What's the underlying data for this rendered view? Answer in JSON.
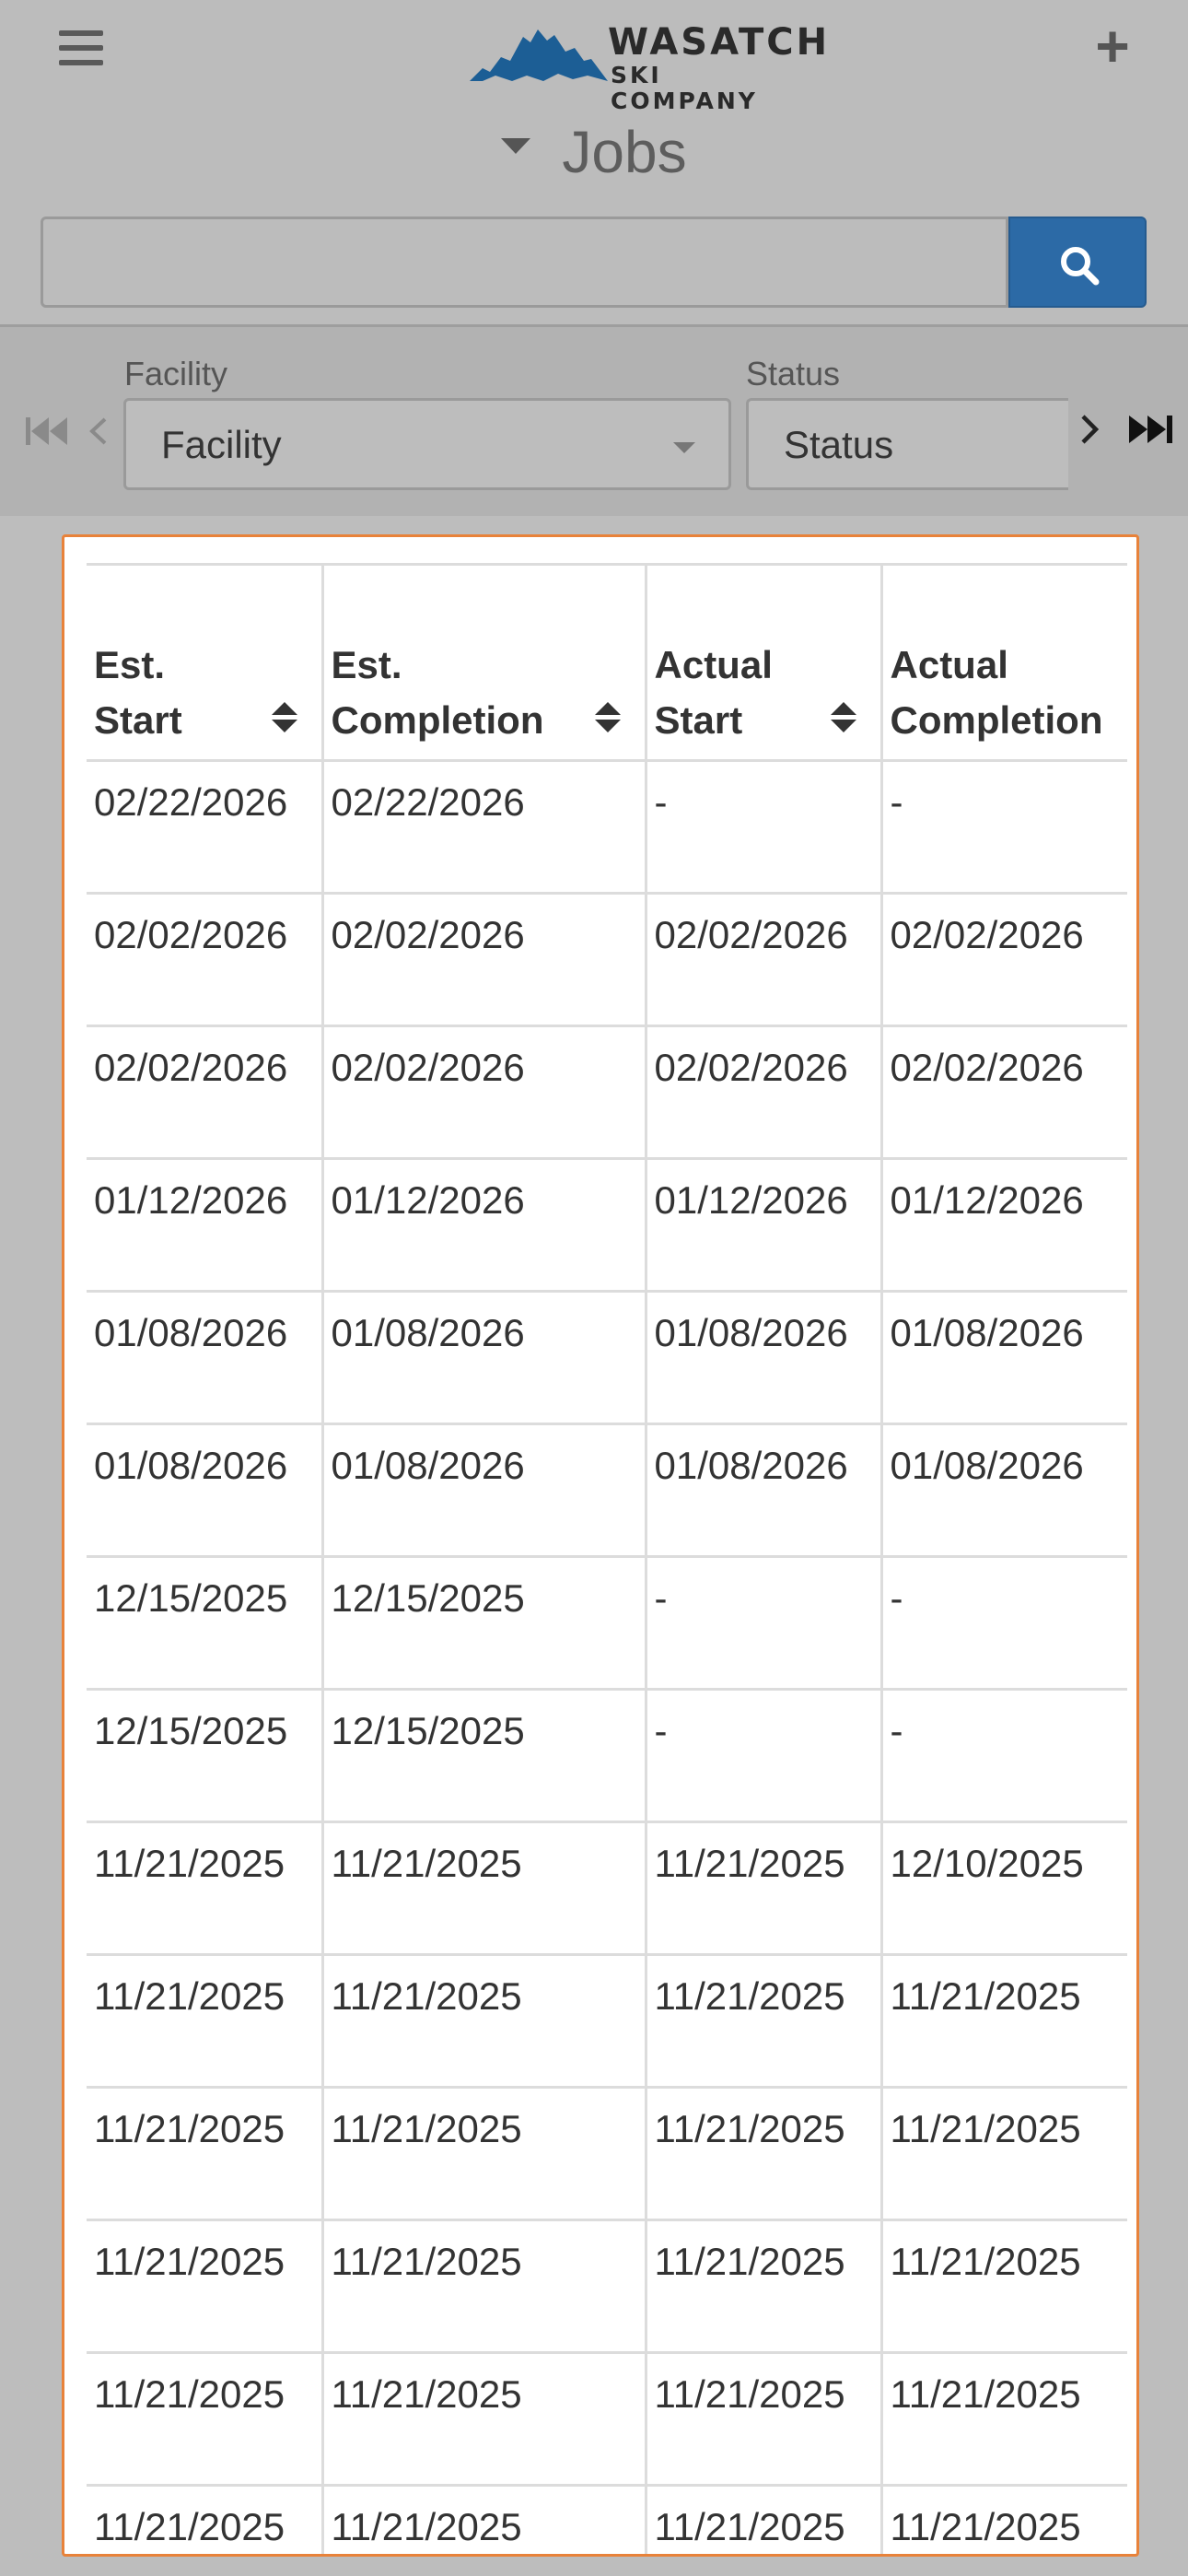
{
  "brand": {
    "line1": "WASATCH",
    "line2": "SKI COMPANY",
    "mountain_color": "#1c5e95"
  },
  "header": {
    "menu_icon": "hamburger-icon",
    "add_icon": "plus-icon",
    "title": "Jobs"
  },
  "search": {
    "value": "",
    "placeholder": "",
    "button_icon": "search-icon",
    "button_color": "#2c6aa6"
  },
  "filters": {
    "facility": {
      "label": "Facility",
      "selected": "Facility"
    },
    "status": {
      "label": "Status",
      "selected": "Status"
    }
  },
  "table": {
    "headers": [
      {
        "line1": "Est.",
        "line2": "Start"
      },
      {
        "line1": "Est.",
        "line2": "Completion"
      },
      {
        "line1": "Actual",
        "line2": "Start"
      },
      {
        "line1": "Actual",
        "line2": "Completion"
      }
    ],
    "rows": [
      [
        "02/22/2026",
        "02/22/2026",
        "-",
        "-"
      ],
      [
        "02/02/2026",
        "02/02/2026",
        "02/02/2026",
        "02/02/2026"
      ],
      [
        "02/02/2026",
        "02/02/2026",
        "02/02/2026",
        "02/02/2026"
      ],
      [
        "01/12/2026",
        "01/12/2026",
        "01/12/2026",
        "01/12/2026"
      ],
      [
        "01/08/2026",
        "01/08/2026",
        "01/08/2026",
        "01/08/2026"
      ],
      [
        "01/08/2026",
        "01/08/2026",
        "01/08/2026",
        "01/08/2026"
      ],
      [
        "12/15/2025",
        "12/15/2025",
        "-",
        "-"
      ],
      [
        "12/15/2025",
        "12/15/2025",
        "-",
        "-"
      ],
      [
        "11/21/2025",
        "11/21/2025",
        "11/21/2025",
        "12/10/2025"
      ],
      [
        "11/21/2025",
        "11/21/2025",
        "11/21/2025",
        "11/21/2025"
      ],
      [
        "11/21/2025",
        "11/21/2025",
        "11/21/2025",
        "11/21/2025"
      ],
      [
        "11/21/2025",
        "11/21/2025",
        "11/21/2025",
        "11/21/2025"
      ],
      [
        "11/21/2025",
        "11/21/2025",
        "11/21/2025",
        "11/21/2025"
      ],
      [
        "11/21/2025",
        "11/21/2025",
        "11/21/2025",
        "11/21/2025"
      ]
    ]
  },
  "accent_color": "#e8823a"
}
